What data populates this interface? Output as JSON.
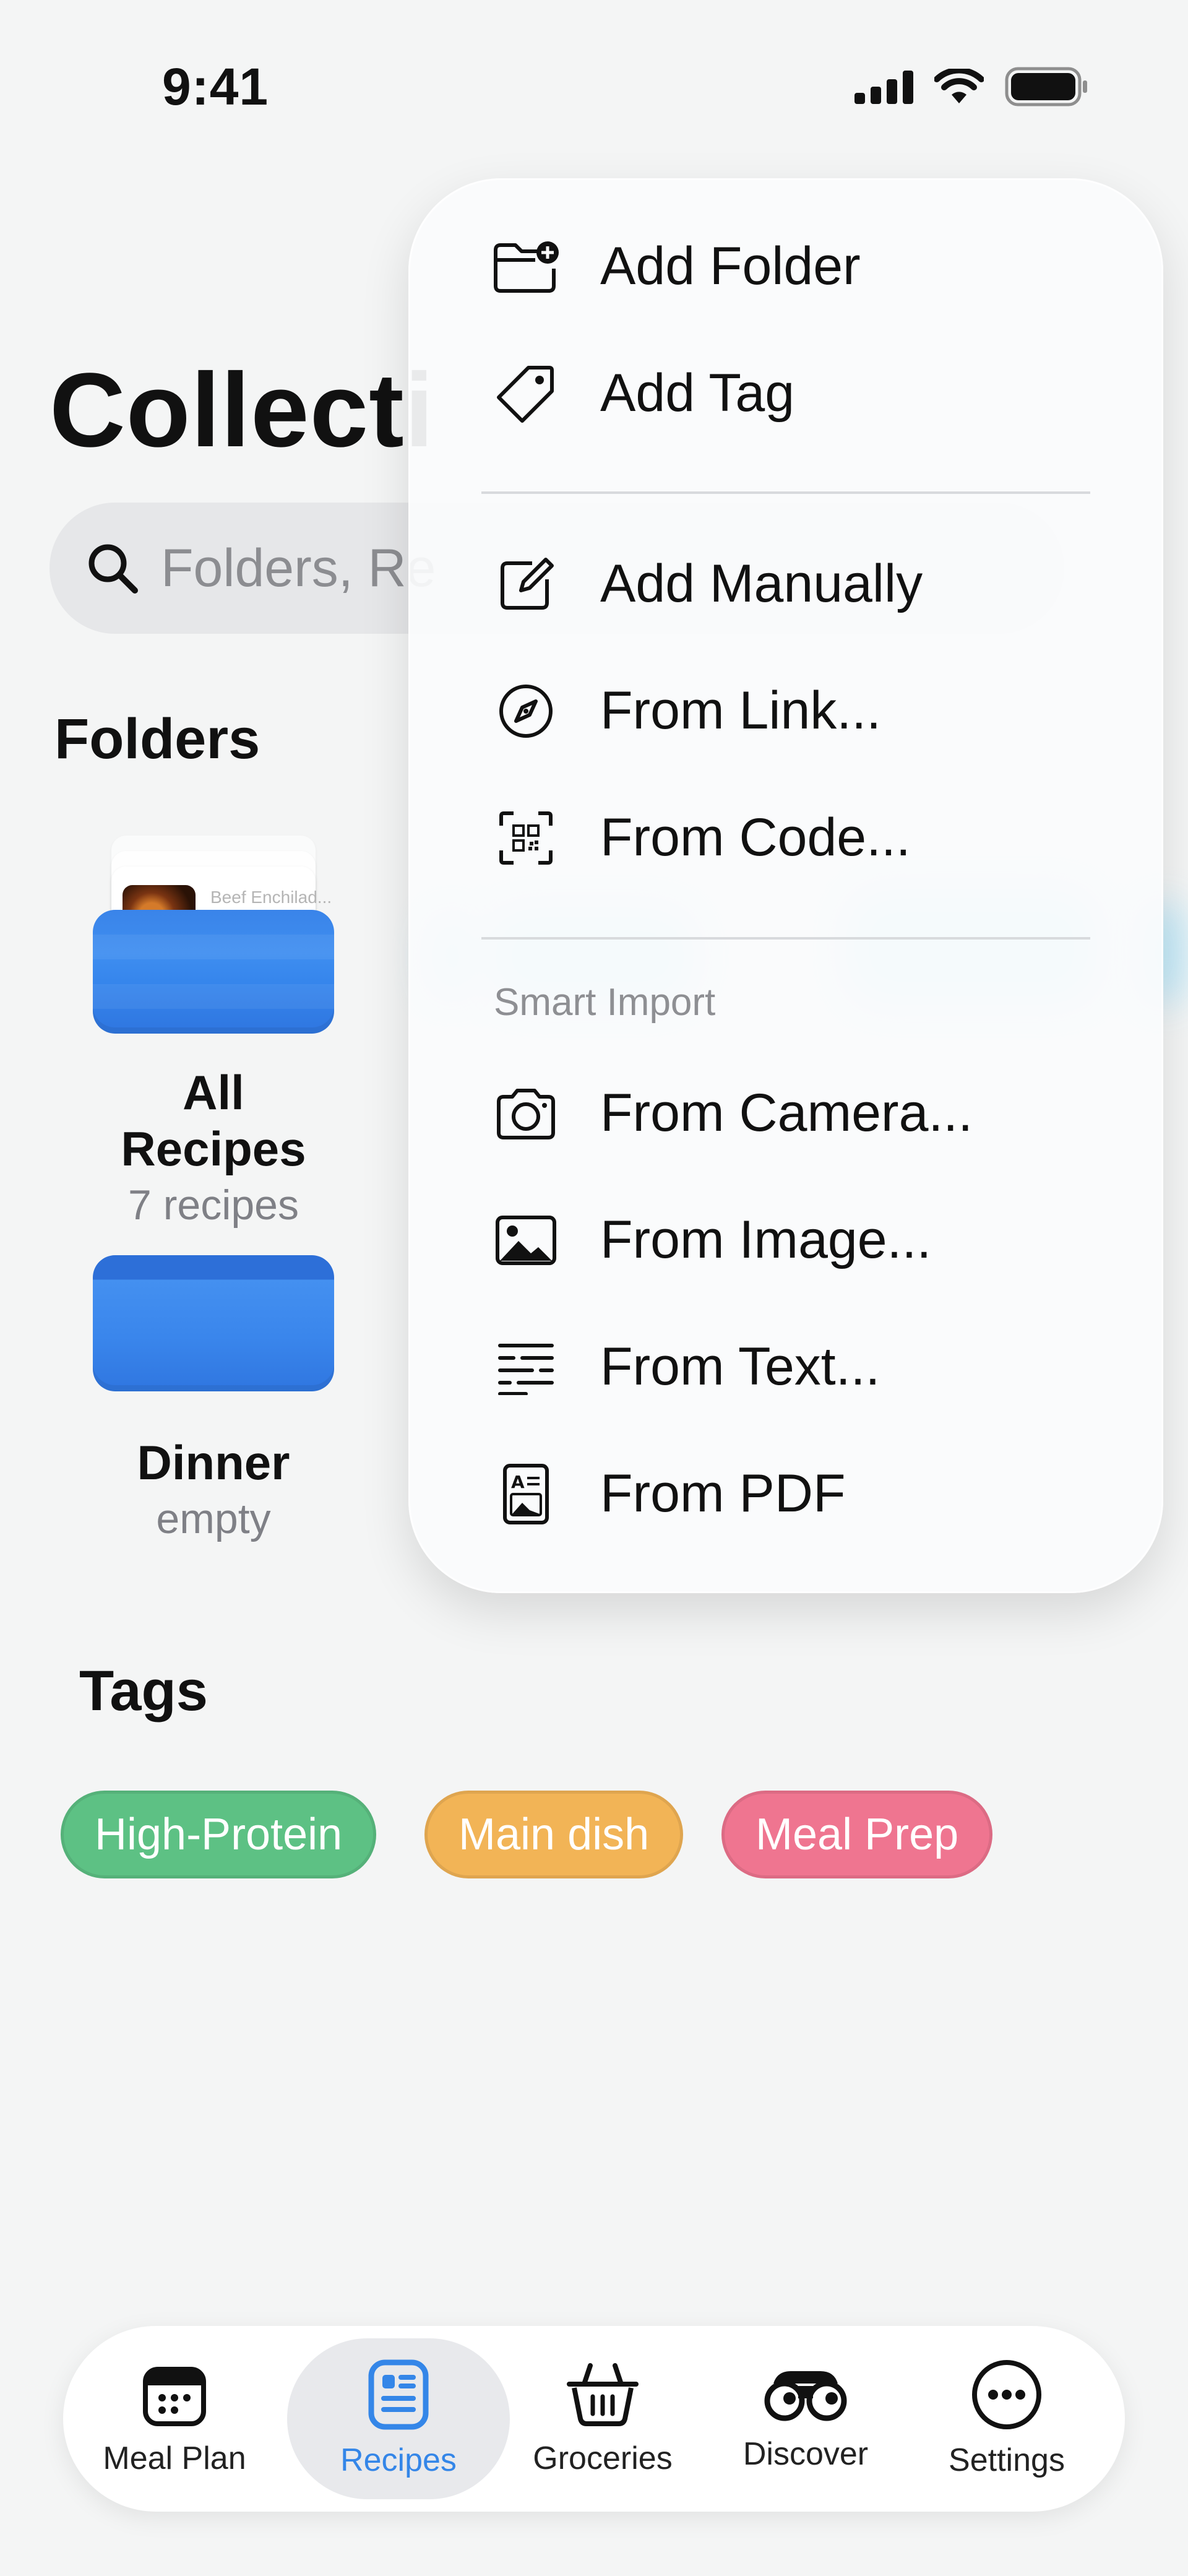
{
  "status_bar": {
    "time": "9:41"
  },
  "page": {
    "title": "Collecti",
    "search_placeholder": "Folders, Re"
  },
  "folders": {
    "heading": "Folders",
    "items": [
      {
        "name": "All Recipes",
        "count": "7 recipes",
        "preview_text": "Beef Enchilad..."
      },
      {
        "name": "Dinner",
        "count": "empty"
      }
    ]
  },
  "tags": {
    "heading": "Tags",
    "items": [
      {
        "label": "High-Protein",
        "color": "#5dc184"
      },
      {
        "label": "Main dish",
        "color": "#f2b456"
      },
      {
        "label": "Meal Prep",
        "color": "#ef7590"
      }
    ]
  },
  "menu": {
    "items": [
      {
        "label": "Add Folder",
        "icon": "folder-plus-icon"
      },
      {
        "label": "Add Tag",
        "icon": "tag-icon"
      },
      {
        "label": "Add Manually",
        "icon": "square-pencil-icon"
      },
      {
        "label": "From Link...",
        "icon": "compass-icon"
      },
      {
        "label": "From Code...",
        "icon": "qr-code-icon"
      }
    ],
    "smart_import_heading": "Smart Import",
    "smart_items": [
      {
        "label": "From Camera...",
        "icon": "camera-icon"
      },
      {
        "label": "From Image...",
        "icon": "photo-icon"
      },
      {
        "label": "From Text...",
        "icon": "text-lines-icon"
      },
      {
        "label": "From PDF",
        "icon": "pdf-document-icon"
      }
    ]
  },
  "tabbar": {
    "tabs": [
      {
        "label": "Meal Plan",
        "icon": "calendar-icon",
        "active": false
      },
      {
        "label": "Recipes",
        "icon": "recipe-book-icon",
        "active": true
      },
      {
        "label": "Groceries",
        "icon": "basket-icon",
        "active": false
      },
      {
        "label": "Discover",
        "icon": "binoculars-icon",
        "active": false
      },
      {
        "label": "Settings",
        "icon": "more-icon",
        "active": false
      }
    ],
    "active_color": "#3486e8"
  }
}
